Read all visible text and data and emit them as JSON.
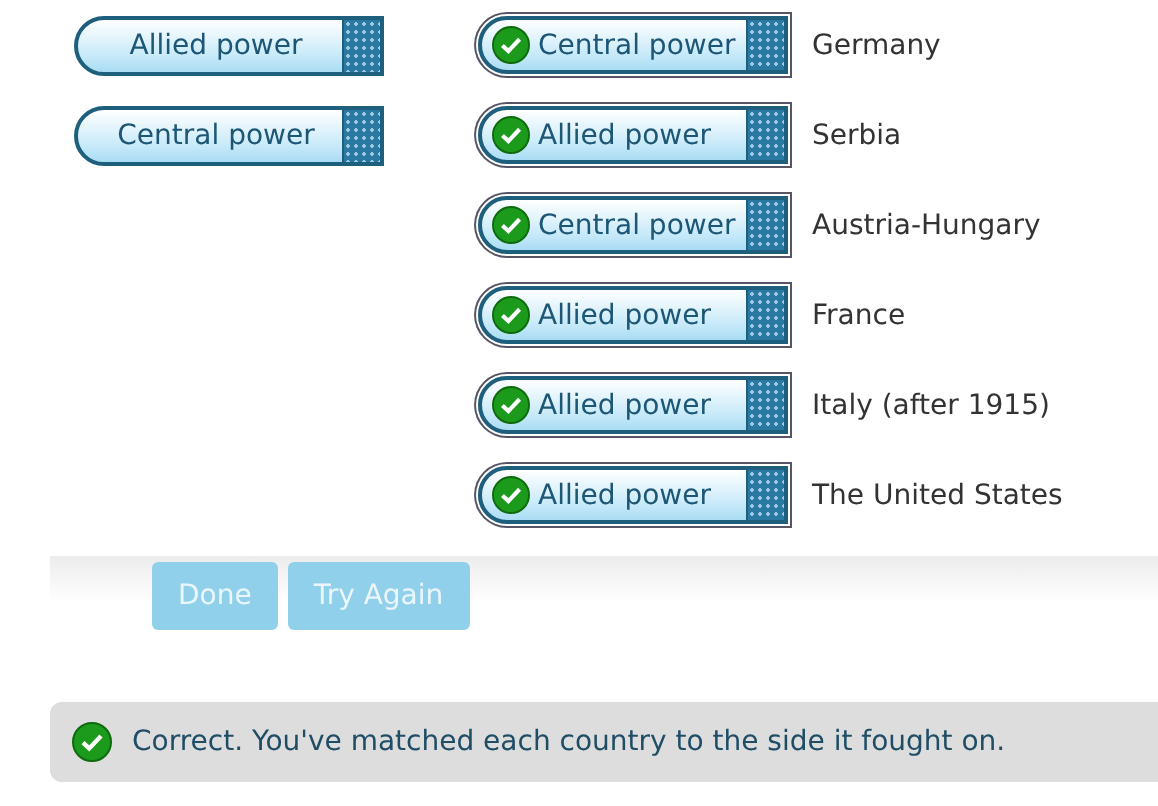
{
  "options": [
    {
      "label": "Allied power"
    },
    {
      "label": "Central power"
    }
  ],
  "matches": [
    {
      "answer": "Central power",
      "correct": true,
      "country": "Germany"
    },
    {
      "answer": "Allied power",
      "correct": true,
      "country": "Serbia"
    },
    {
      "answer": "Central power",
      "correct": true,
      "country": "Austria-Hungary"
    },
    {
      "answer": "Allied power",
      "correct": true,
      "country": "France"
    },
    {
      "answer": "Allied power",
      "correct": true,
      "country": "Italy (after 1915)"
    },
    {
      "answer": "Allied power",
      "correct": true,
      "country": "The United States"
    }
  ],
  "buttons": [
    {
      "label": "Done",
      "disabled": true
    },
    {
      "label": "Try Again",
      "disabled": true
    }
  ],
  "feedback": {
    "text": "Correct. You've matched each country to the side it fought on.",
    "correct": true
  }
}
